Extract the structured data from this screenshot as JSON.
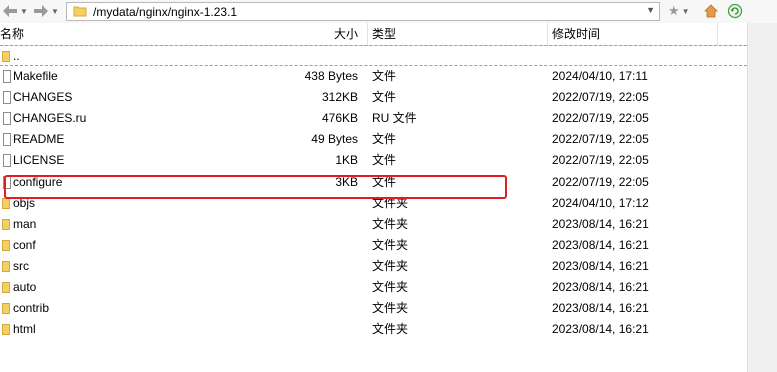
{
  "path_bar": {
    "path": "/mydata/nginx/nginx-1.23.1"
  },
  "columns": {
    "name": "名称",
    "size": "大小",
    "type": "类型",
    "modified": "修改时间"
  },
  "rows": [
    {
      "name": "..",
      "size": "",
      "type": "",
      "date": "",
      "kind": "folder"
    },
    {
      "name": "Makefile",
      "size": "438 Bytes",
      "type": "文件",
      "date": "2024/04/10, 17:11",
      "kind": "file"
    },
    {
      "name": "CHANGES",
      "size": "312KB",
      "type": "文件",
      "date": "2022/07/19, 22:05",
      "kind": "file"
    },
    {
      "name": "CHANGES.ru",
      "size": "476KB",
      "type": "RU 文件",
      "date": "2022/07/19, 22:05",
      "kind": "file"
    },
    {
      "name": "README",
      "size": "49 Bytes",
      "type": "文件",
      "date": "2022/07/19, 22:05",
      "kind": "file"
    },
    {
      "name": "LICENSE",
      "size": "1KB",
      "type": "文件",
      "date": "2022/07/19, 22:05",
      "kind": "file"
    },
    {
      "name": "configure",
      "size": "3KB",
      "type": "文件",
      "date": "2022/07/19, 22:05",
      "kind": "file"
    },
    {
      "name": "objs",
      "size": "",
      "type": "文件夹",
      "date": "2024/04/10, 17:12",
      "kind": "folder"
    },
    {
      "name": "man",
      "size": "",
      "type": "文件夹",
      "date": "2023/08/14, 16:21",
      "kind": "folder"
    },
    {
      "name": "conf",
      "size": "",
      "type": "文件夹",
      "date": "2023/08/14, 16:21",
      "kind": "folder"
    },
    {
      "name": "src",
      "size": "",
      "type": "文件夹",
      "date": "2023/08/14, 16:21",
      "kind": "folder"
    },
    {
      "name": "auto",
      "size": "",
      "type": "文件夹",
      "date": "2023/08/14, 16:21",
      "kind": "folder"
    },
    {
      "name": "contrib",
      "size": "",
      "type": "文件夹",
      "date": "2023/08/14, 16:21",
      "kind": "folder"
    },
    {
      "name": "html",
      "size": "",
      "type": "文件夹",
      "date": "2023/08/14, 16:21",
      "kind": "folder"
    }
  ],
  "highlight": {
    "row_name": "configure",
    "color": "#e02020"
  },
  "colors": {
    "folder": "#f5cf63",
    "focus_border": "#7aa7d8"
  }
}
